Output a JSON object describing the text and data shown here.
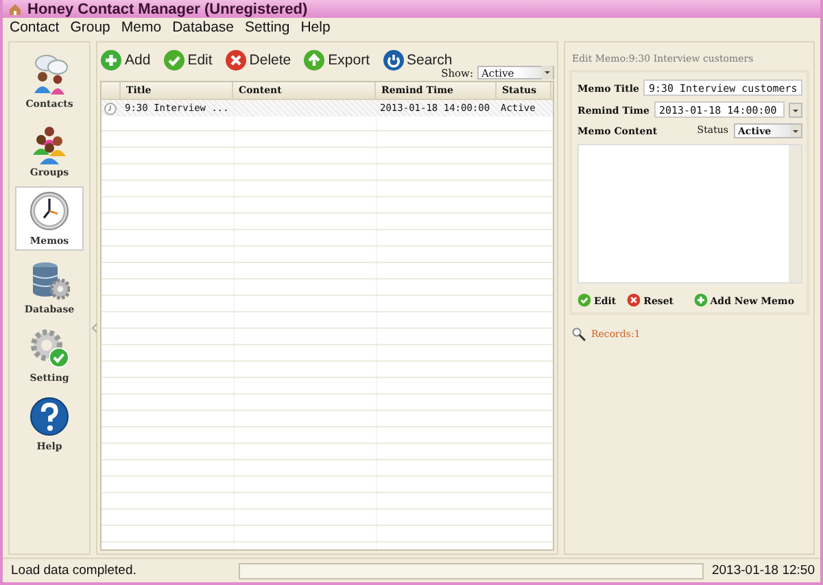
{
  "window": {
    "title": "Honey Contact Manager (Unregistered)"
  },
  "menu": [
    "Contact",
    "Group",
    "Memo",
    "Database",
    "Setting",
    "Help"
  ],
  "sidebar": {
    "items": [
      {
        "label": "Contacts",
        "kind": "contacts",
        "selected": false
      },
      {
        "label": "Groups",
        "kind": "groups",
        "selected": false
      },
      {
        "label": "Memos",
        "kind": "memos",
        "selected": true
      },
      {
        "label": "Database",
        "kind": "database",
        "selected": false
      },
      {
        "label": "Setting",
        "kind": "setting",
        "selected": false
      },
      {
        "label": "Help",
        "kind": "help",
        "selected": false
      }
    ]
  },
  "toolbar": {
    "buttons": [
      {
        "label": "Add",
        "kind": "add"
      },
      {
        "label": "Edit",
        "kind": "edit"
      },
      {
        "label": "Delete",
        "kind": "delete"
      },
      {
        "label": "Export",
        "kind": "export"
      },
      {
        "label": "Search",
        "kind": "search"
      }
    ],
    "show_label": "Show:",
    "show_value": "Active"
  },
  "table": {
    "columns": [
      "Title",
      "Content",
      "Remind Time",
      "Status"
    ],
    "rows": [
      {
        "title": "9:30 Interview ...",
        "remind_time": "2013-01-18 14:00:00",
        "status": "Active",
        "selected": true
      }
    ]
  },
  "editor": {
    "heading": "Edit Memo:9:30 Interview customers",
    "title_label": "Memo Title",
    "title_value": "9:30 Interview customers",
    "remind_label": "Remind Time",
    "remind_value": "2013-01-18 14:00:00",
    "content_label": "Memo Content",
    "status_label": "Status",
    "status_value": "Active",
    "buttons": [
      {
        "label": "Edit",
        "kind": "edit"
      },
      {
        "label": "Reset",
        "kind": "reset"
      },
      {
        "label": "Add New Memo",
        "kind": "add"
      }
    ],
    "records": "Records:1"
  },
  "status_bar": {
    "message": "Load data completed.",
    "progress": {
      "level": 0
    },
    "datetime": "2013-01-18 12:50"
  }
}
